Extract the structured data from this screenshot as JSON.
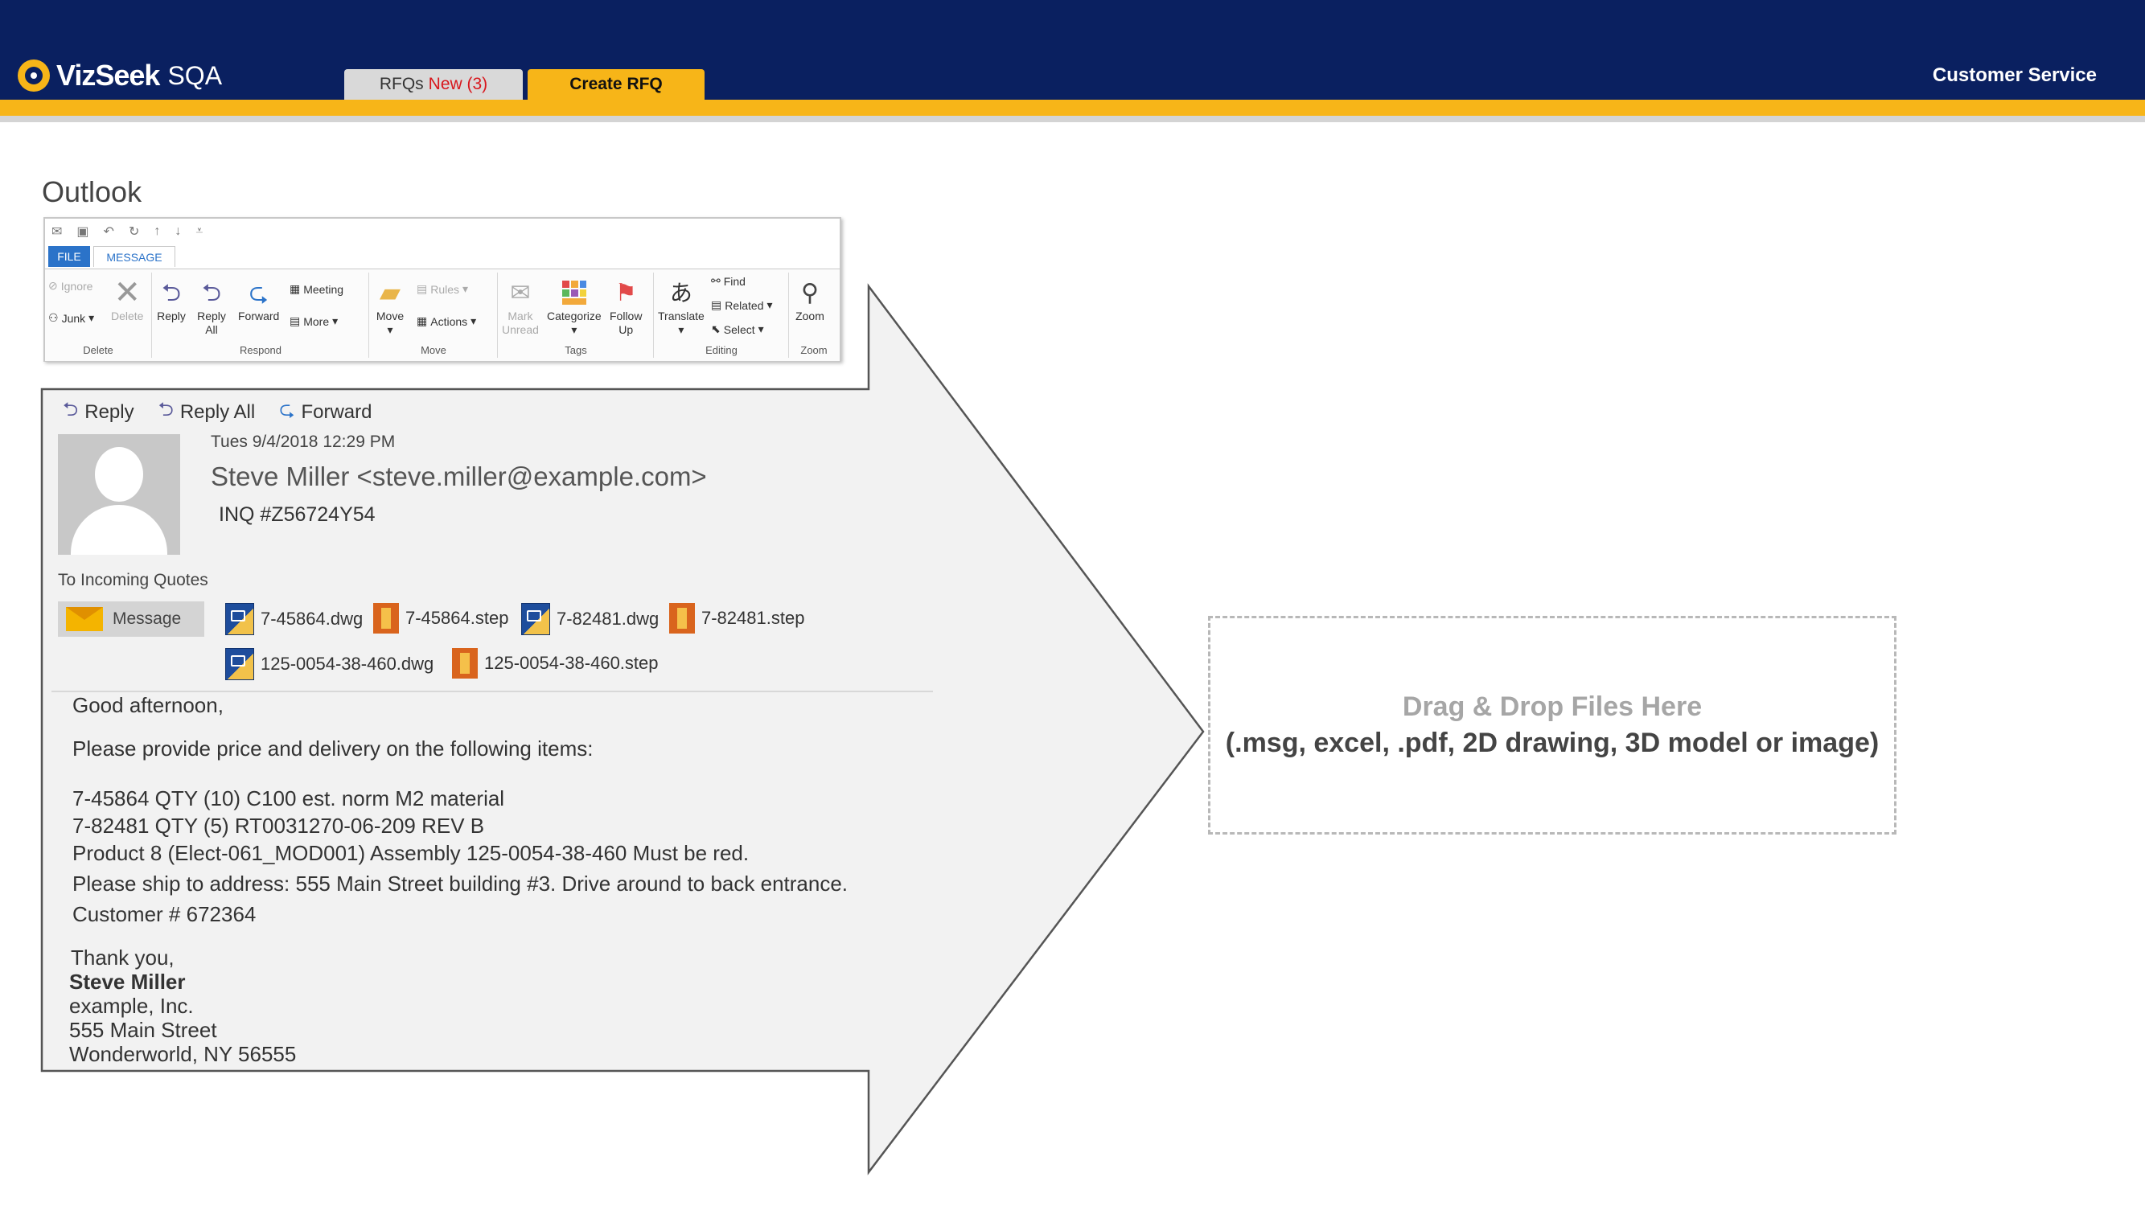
{
  "header": {
    "brand_name": "VizSeek",
    "brand_suffix": "SQA",
    "tabs": [
      {
        "label": "RFQs",
        "badge": "New (3)"
      },
      {
        "label": "Create RFQ"
      }
    ],
    "right_link": "Customer Service",
    "colors": {
      "navy": "#0a2060",
      "accent": "#f7b518",
      "badge_red": "#d8161c"
    }
  },
  "section_title": "Outlook",
  "ribbon": {
    "tabs": [
      "FILE",
      "MESSAGE"
    ],
    "groups": {
      "delete": {
        "label": "Delete",
        "ignore": "Ignore",
        "junk": "Junk",
        "delete": "Delete"
      },
      "respond": {
        "label": "Respond",
        "reply": "Reply",
        "reply_all_1": "Reply",
        "reply_all_2": "All",
        "forward": "Forward",
        "meeting": "Meeting",
        "more": "More"
      },
      "move": {
        "label": "Move",
        "move": "Move",
        "rules": "Rules",
        "actions": "Actions"
      },
      "tags": {
        "label": "Tags",
        "mark_1": "Mark",
        "mark_2": "Unread",
        "categorize": "Categorize",
        "follow_1": "Follow",
        "follow_2": "Up"
      },
      "editing": {
        "label": "Editing",
        "translate": "Translate",
        "find": "Find",
        "related": "Related",
        "select": "Select"
      },
      "zoom": {
        "label": "Zoom",
        "zoom": "Zoom"
      }
    }
  },
  "email": {
    "actions": [
      "Reply",
      "Reply All",
      "Forward"
    ],
    "date": "Tues 9/4/2018 12:29 PM",
    "sender": "Steve Miller <steve.miller@example.com>",
    "subject": "INQ #Z56724Y54",
    "to": "To  Incoming Quotes",
    "message_tab": "Message",
    "attachments": [
      {
        "name": "7-45864.dwg",
        "type": "dwg"
      },
      {
        "name": "7-45864.step",
        "type": "step"
      },
      {
        "name": "7-82481.dwg",
        "type": "dwg"
      },
      {
        "name": "7-82481.step",
        "type": "step"
      },
      {
        "name": "125-0054-38-460.dwg",
        "type": "dwg"
      },
      {
        "name": "125-0054-38-460.step",
        "type": "step"
      }
    ],
    "body": {
      "greeting": "Good afternoon,",
      "request": "Please provide price and delivery on the following items:",
      "lines": [
        "7-45864 QTY (10) C100 est. norm M2 material",
        "7-82481 QTY (5) RT0031270-06-209 REV B",
        "Product 8 (Elect-061_MOD001) Assembly 125-0054-38-460 Must be red.",
        "Please ship to address: 555 Main Street building #3. Drive around to back entrance.",
        "Customer # 672364"
      ],
      "thanks": "Thank you,",
      "signature_name": "Steve Miller",
      "signature_lines": [
        "example, Inc.",
        "555 Main Street",
        "Wonderworld, NY 56555"
      ]
    }
  },
  "dropzone": {
    "title": "Drag & Drop Files Here",
    "subtitle": "(.msg, excel, .pdf, 2D drawing, 3D model or image)"
  }
}
